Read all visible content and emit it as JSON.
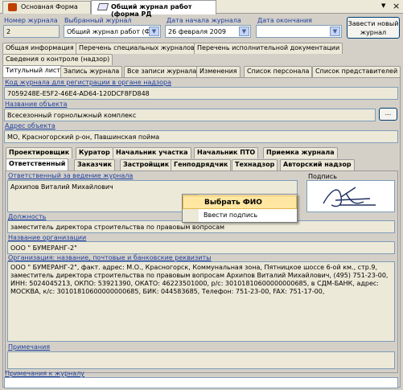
{
  "window_tabs": [
    {
      "label": "Основная Форма",
      "icon": "home-icon"
    },
    {
      "label": "Общий журнал работ (форма РД",
      "icon": "journal-icon"
    }
  ],
  "window_controls": {
    "dropdown": "▼",
    "close": "×"
  },
  "header": {
    "number_label": "Номер журнала",
    "number_value": "2",
    "selected_label": "Выбранный журнал",
    "selected_value": "Общий журнал работ (Фо",
    "start_date_label": "Дата начала журнала",
    "start_date_value": "26 февраля  2009",
    "end_date_label": "Дата окончания",
    "end_date_value": "",
    "new_journal_button": "Завести новый журнал"
  },
  "section_tabs_row1": [
    "Общая информация",
    "Перечень специальных журналов",
    "Перечень исполнительной документации"
  ],
  "section_tabs_row2": [
    "Сведения о контроле (надзор)"
  ],
  "section_tabs_row3": [
    "Титульный лист",
    "Запись журнала",
    "Все записи журнала",
    "Изменения",
    "Список персонала",
    "Список представителей"
  ],
  "title_page": {
    "code_label": "Код журнала для регистрации в органе надзора",
    "code_value": "7059248E-E5F2-46E4-AD64-120DCF8FD848",
    "object_label": "Название объекта",
    "object_value": "Всесезонный горнолыжный комплекс",
    "browse_button": "...",
    "address_label": "Адрес объекта",
    "address_value": "МО, Красногорский р-он, Павшинская пойма"
  },
  "role_tabs_row1": [
    "Проектировщик",
    "Куратор",
    "Начальник участка",
    "Начальник ПТО",
    "Приемка журнала"
  ],
  "role_tabs_row2": [
    "Ответственный",
    "Заказчик",
    "Застройщик",
    "Генподрядчик",
    "Технадзор",
    "Авторский надзор"
  ],
  "responsible": {
    "person_label": "Ответственный за ведение журнала",
    "person_value": "Архипов Виталий Михайлович",
    "signature_label": "Подпись",
    "position_label": "Должность",
    "position_value": "заместитель директора строительства по правовым вопросам",
    "org_label": "Название организации",
    "org_value": "ООО \" БУМЕРАНГ-2\"",
    "details_label": "Организация: название, почтовые и банковские реквизиты",
    "details_value": "ООО \" БУМЕРАНГ-2\", факт. адрес: М.О., Красногорск, Коммунальная зона, Пятницкое шоссе 6-ой км., стр.9, заместитель директора строительства по правовым вопросам Архипов Виталий Михайлович, (495) 751-23-00, ИНН: 5024045213, ОКПО: 53921390, ОКАТО: 46223501000, р/с: 30101810600000000685,  в СДМ-БАНК, адрес: МОСКВА, к/с: 30101810600000000685, БИК: 044583685, Телефон: 751-23-00, FAX: 751-17-00,",
    "notes_label": "Примечания",
    "notes_value": ""
  },
  "journal_notes_label": "Примечания к журналу",
  "journal_notes_value": "",
  "context_menu": {
    "items": [
      "Выбрать ФИО",
      "Ввести подпись"
    ]
  },
  "colors": {
    "accent": "#1f3f9f",
    "menu_highlight": "#316ac5"
  }
}
